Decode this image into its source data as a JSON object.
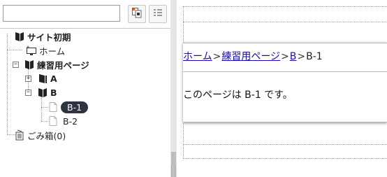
{
  "search": {
    "value": "",
    "placeholder": ""
  },
  "toolbar": {
    "btn1_icon": "page-select-icon",
    "btn2_icon": "list-view-icon"
  },
  "tree": {
    "root_label": "サイト初期",
    "home_label": "ホーム",
    "practice_label": "練習用ページ",
    "a_label": "A",
    "b_label": "B",
    "b1_label": "B-1",
    "b2_label": "B-2",
    "trash_label": "ごみ箱(0)",
    "toggle_minus": "−",
    "toggle_plus": "+"
  },
  "preview": {
    "breadcrumb": {
      "home": "ホーム",
      "practice": "練習用ページ",
      "b": "B",
      "current": "B-1",
      "separator": ">"
    },
    "body_text": "このページは B-1 です。"
  },
  "colors": {
    "selected_bg": "#2d3340",
    "link": "#1a0dab"
  }
}
